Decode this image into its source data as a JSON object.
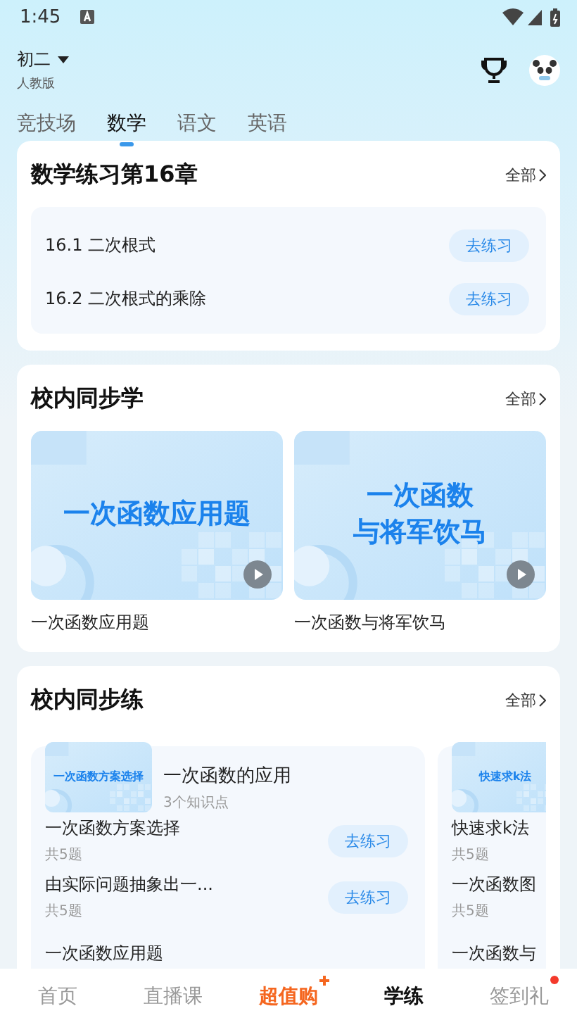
{
  "status_bar": {
    "time": "1:45"
  },
  "header": {
    "grade": "初二",
    "edition": "人教版"
  },
  "tabs": [
    {
      "label": "竞技场",
      "selected": false
    },
    {
      "label": "数学",
      "selected": true
    },
    {
      "label": "语文",
      "selected": false
    },
    {
      "label": "英语",
      "selected": false
    }
  ],
  "sections": [
    {
      "kind": "chapter",
      "title": "数学练习第16章",
      "more": "全部",
      "items": [
        {
          "name": "16.1 二次根式",
          "button": "去练习"
        },
        {
          "name": "16.2 二次根式的乘除",
          "button": "去练习"
        }
      ]
    },
    {
      "kind": "videos",
      "title": "校内同步学",
      "more": "全部",
      "videos": [
        {
          "thumb_lines": [
            "一次函数应用题"
          ],
          "caption": "一次函数应用题"
        },
        {
          "thumb_lines": [
            "一次函数",
            "与将军饮马"
          ],
          "caption": "一次函数与将军饮马"
        }
      ]
    },
    {
      "kind": "practice",
      "title": "校内同步练",
      "more": "全部",
      "groups": [
        {
          "thumb_title": "一次函数方案选择",
          "name": "一次函数的应用",
          "count": "3个知识点",
          "items": [
            {
              "name": "一次函数方案选择",
              "count": "共5题",
              "button": "去练习"
            },
            {
              "name": "由实际问题抽象出一...",
              "count": "共5题",
              "button": "去练习"
            },
            {
              "name": "一次函数应用题"
            }
          ]
        },
        {
          "thumb_title": "快速求k法",
          "items": [
            {
              "name": "快速求k法",
              "count": "共5题"
            },
            {
              "name": "一次函数图",
              "count": "共5题"
            },
            {
              "name": "一次函数与"
            }
          ]
        }
      ]
    }
  ],
  "bottom_nav": [
    {
      "label": "首页",
      "selected": false,
      "kind": "plain",
      "badge": false
    },
    {
      "label": "直播课",
      "selected": false,
      "kind": "plain",
      "badge": false
    },
    {
      "label": "超值购",
      "selected": false,
      "kind": "promo",
      "badge": false
    },
    {
      "label": "学练",
      "selected": true,
      "kind": "plain",
      "badge": false
    },
    {
      "label": "签到礼",
      "selected": false,
      "kind": "plain",
      "badge": true
    }
  ]
}
